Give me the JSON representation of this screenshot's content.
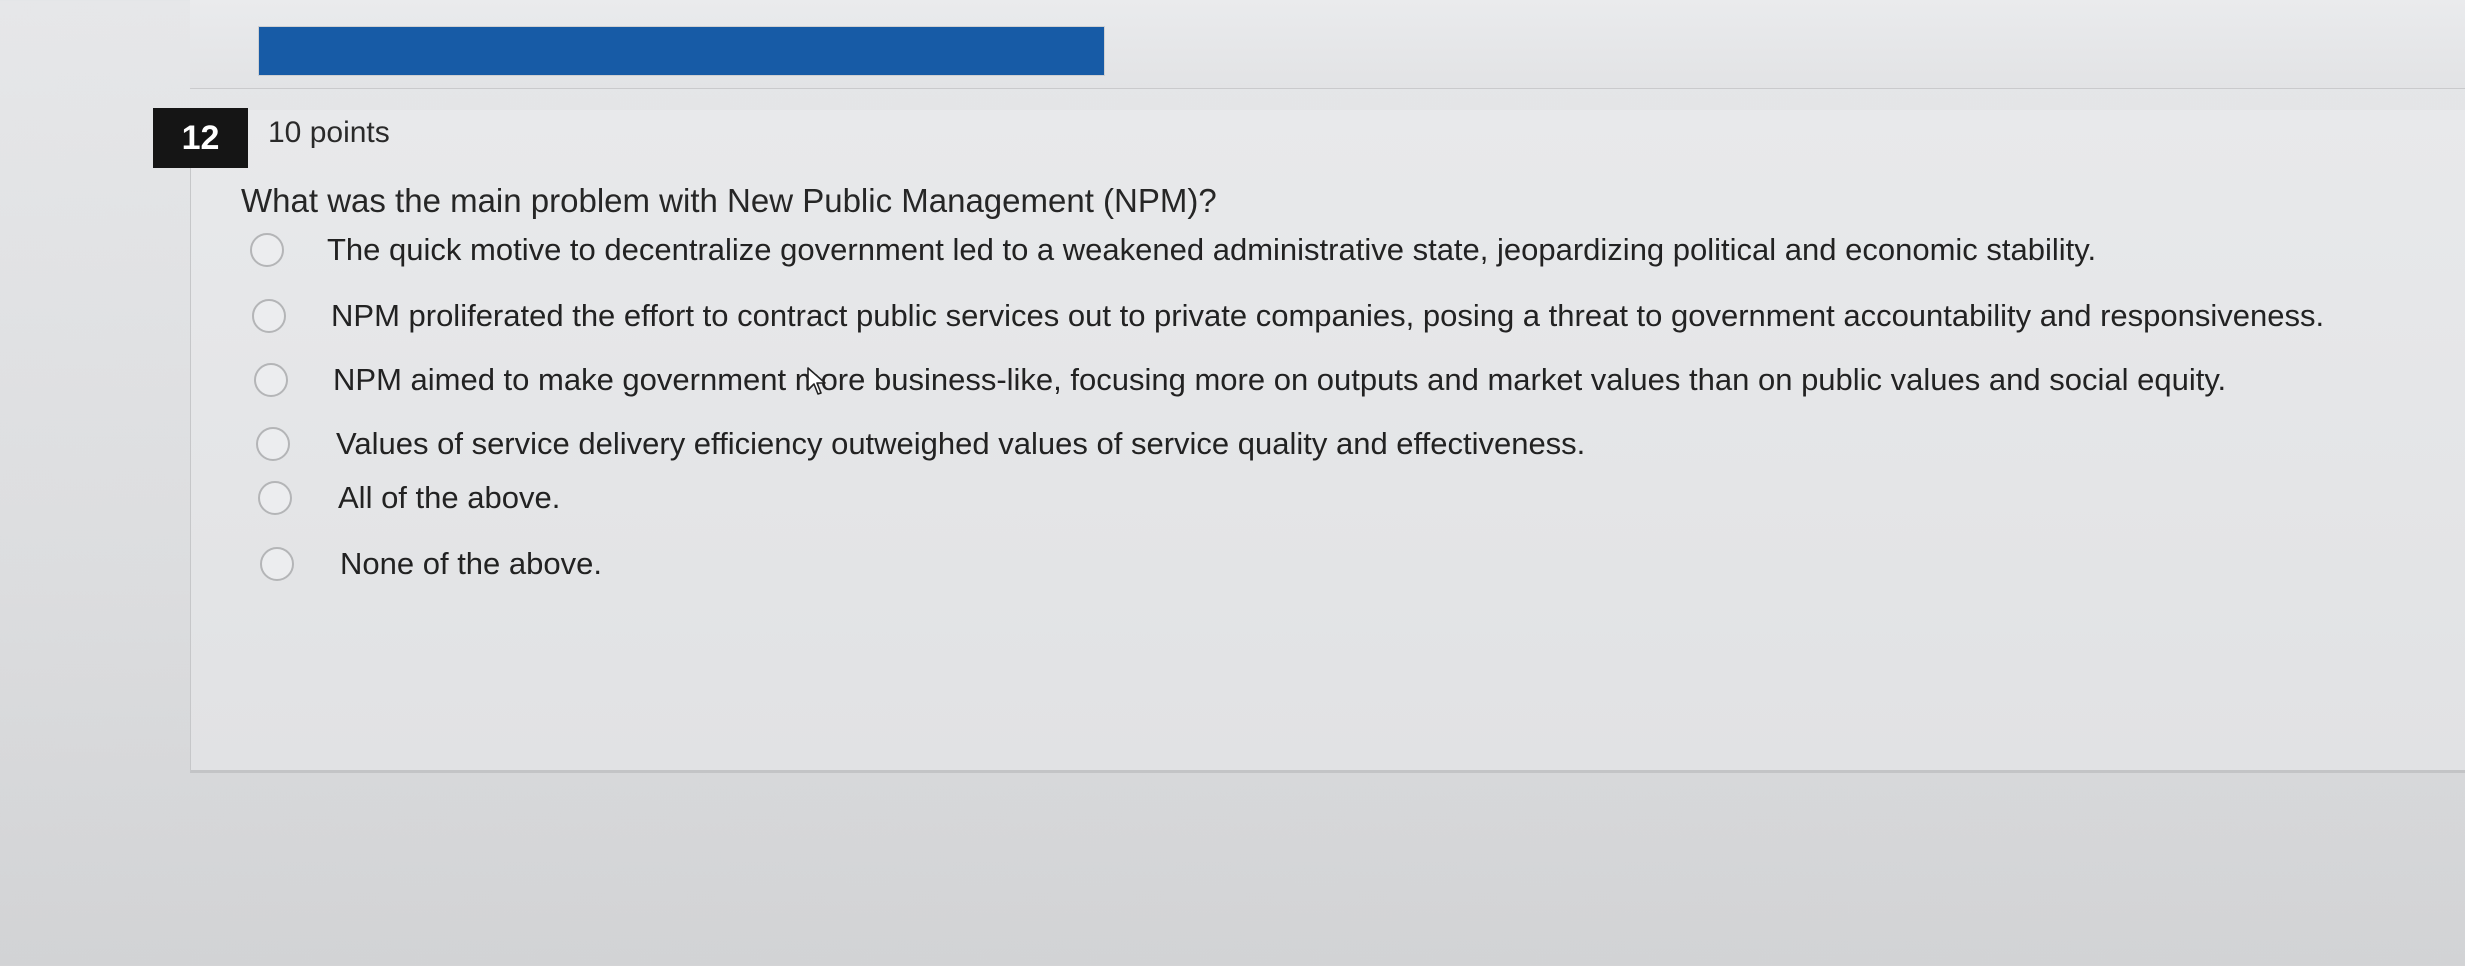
{
  "progress": {
    "fill_fraction": 1.0,
    "color": "#175ba6"
  },
  "question": {
    "number": "12",
    "points": "10 points",
    "text": "What was the main problem with New Public Management (NPM)?",
    "options": [
      {
        "label": "The quick motive to decentralize government led to a weakened administrative state, jeopardizing political and economic stability."
      },
      {
        "label": "NPM proliferated the effort to contract public services out to private companies, posing a threat to government accountability and responsiveness."
      },
      {
        "label": "NPM aimed to make government more business-like, focusing more on outputs and market values than on public values and social equity."
      },
      {
        "label": "Values of service delivery efficiency outweighed values of service quality and effectiveness."
      },
      {
        "label": "All of the above."
      },
      {
        "label": "None of the above."
      }
    ]
  }
}
